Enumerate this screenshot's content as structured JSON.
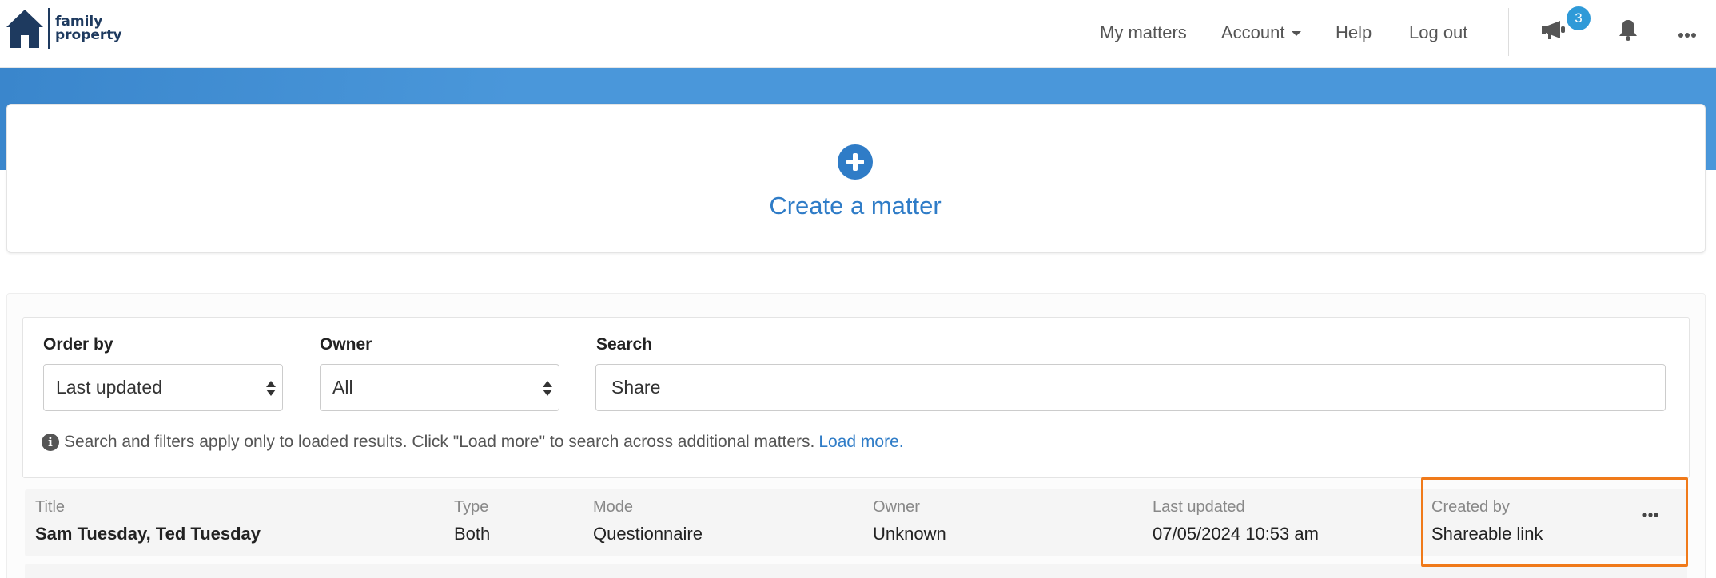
{
  "brand": {
    "line1": "family",
    "line2": "property",
    "colors": {
      "navy": "#1e3a5f",
      "accent": "#2f7cc7",
      "highlight": "#f07a1a"
    }
  },
  "nav": {
    "my_matters": "My matters",
    "account": "Account",
    "help": "Help",
    "logout": "Log out",
    "announcements_badge": "3",
    "icons": [
      "megaphone-icon",
      "bell-icon",
      "more-horizontal-icon"
    ]
  },
  "create": {
    "label": "Create a matter",
    "icon": "plus-circle-icon"
  },
  "filters": {
    "order_by": {
      "label": "Order by",
      "value": "Last updated"
    },
    "owner": {
      "label": "Owner",
      "value": "All"
    },
    "search": {
      "label": "Search",
      "value": "Share"
    },
    "info_text": "Search and filters apply only to loaded results. Click \"Load more\" to search across additional matters.",
    "load_more": "Load more."
  },
  "results": {
    "columns": {
      "title": "Title",
      "type": "Type",
      "mode": "Mode",
      "owner": "Owner",
      "last_updated": "Last updated",
      "created_by": "Created by"
    },
    "rows": [
      {
        "title": "Sam Tuesday, Ted Tuesday",
        "type": "Both",
        "mode": "Questionnaire",
        "owner": "Unknown",
        "last_updated": "07/05/2024 10:53 am",
        "created_by": "Shareable link"
      }
    ]
  }
}
